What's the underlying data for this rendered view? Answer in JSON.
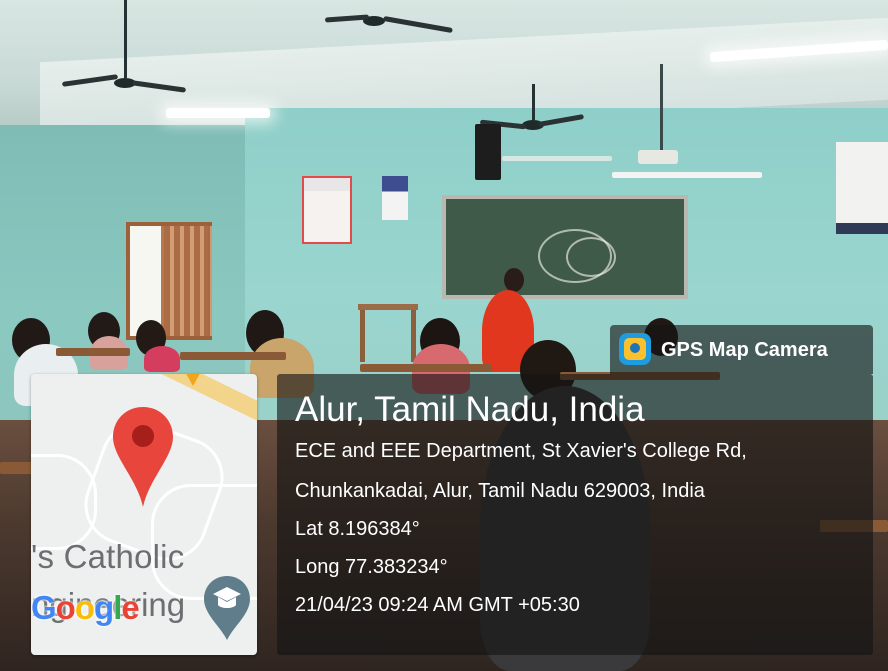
{
  "badge": {
    "label": "GPS Map Camera",
    "icon": "gps-map-camera-app-icon"
  },
  "map": {
    "place_label_line1": "'s Catholic",
    "place_label_line2": "ngineering",
    "logo_text": "Google",
    "logo_colors": [
      "#4285F4",
      "#EA4335",
      "#FBBC05",
      "#4285F4",
      "#34A853",
      "#EA4335"
    ],
    "pin_color": "#E8453C",
    "poi_icon": "education-graduation-cap-icon"
  },
  "location": {
    "title": "Alur, Tamil Nadu, India",
    "address_line1": "ECE and EEE Department, St Xavier's College Rd,",
    "address_line2": "Chunkankadai, Alur, Tamil Nadu 629003, India",
    "lat": "Lat 8.196384°",
    "long": "Long 77.383234°",
    "timestamp": "21/04/23 09:24 AM GMT +05:30"
  }
}
